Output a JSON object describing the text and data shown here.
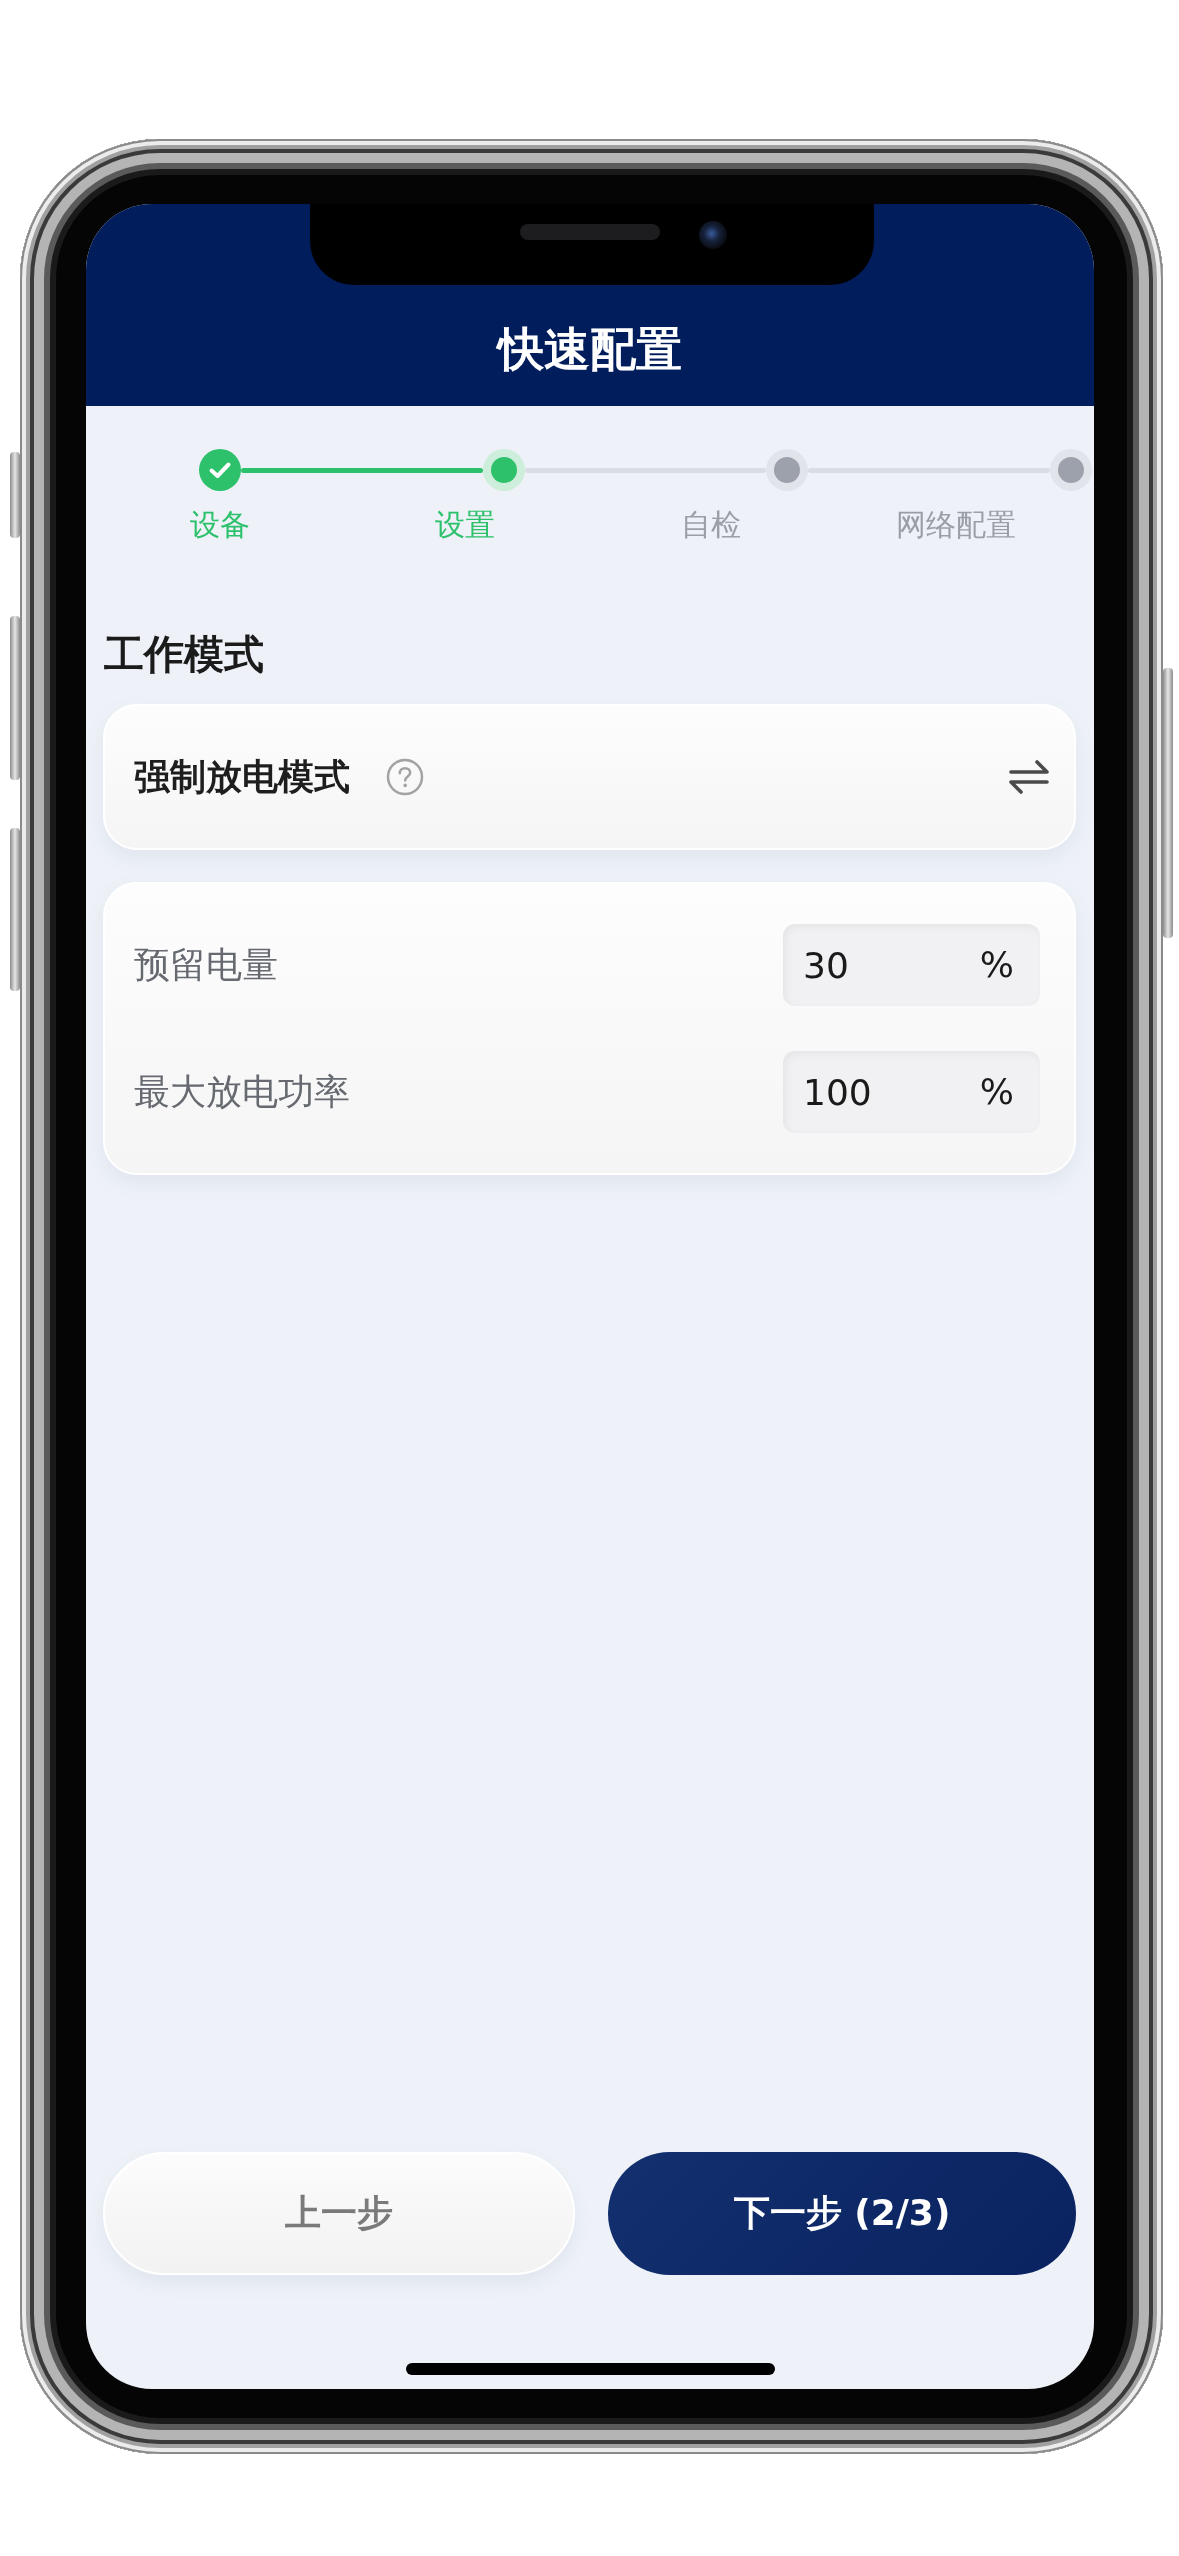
{
  "header": {
    "title": "快速配置"
  },
  "steps": [
    {
      "label": "设备",
      "done": true,
      "selected": false
    },
    {
      "label": "设置",
      "done": false,
      "selected": true
    },
    {
      "label": "自检",
      "done": false,
      "selected": false
    },
    {
      "label": "网络配置",
      "done": false,
      "selected": false
    }
  ],
  "work_mode": {
    "title": "工作模式",
    "mode": "强制放电模式"
  },
  "settings": [
    {
      "label": "预留电量",
      "value": "30",
      "unit": "%"
    },
    {
      "label": "最大放电功率",
      "value": "100",
      "unit": "%"
    }
  ],
  "buttons": [
    {
      "label": "上一步",
      "kind": "secondary"
    },
    {
      "label": "下一步 (2/3)",
      "kind": "primary"
    }
  ]
}
